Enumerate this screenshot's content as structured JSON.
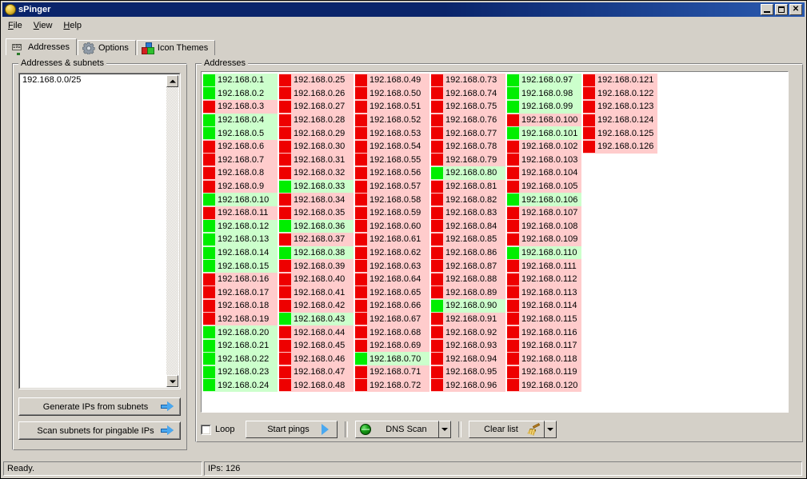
{
  "window": {
    "title": "sPinger",
    "icon": "app-ball-icon",
    "minimize_label": "Minimize",
    "maximize_label": "Maximize",
    "close_label": "Close"
  },
  "menu": {
    "items": [
      {
        "label": "File"
      },
      {
        "label": "View"
      },
      {
        "label": "Help"
      }
    ]
  },
  "tabs": [
    {
      "label": "Addresses",
      "icon": "ip-display-icon",
      "active": true
    },
    {
      "label": "Options",
      "icon": "gear-icon",
      "active": false
    },
    {
      "label": "Icon Themes",
      "icon": "blocks-icon",
      "active": false
    }
  ],
  "left_panel": {
    "group_title": "Addresses & subnets",
    "textarea_value": "192.168.0.0/25",
    "scroll_up_icon": "scroll-up-arrow-icon",
    "scroll_down_icon": "scroll-down-arrow-icon",
    "buttons": [
      {
        "label": "Generate IPs from subnets",
        "icon": "blue-right-arrow-icon"
      },
      {
        "label": "Scan subnets for pingable IPs",
        "icon": "blue-right-arrow-icon"
      }
    ]
  },
  "right_panel": {
    "group_title": "Addresses"
  },
  "toolbar": {
    "loop_label": "Loop",
    "loop_checked": false,
    "start_pings_label": "Start pings",
    "start_pings_icon": "play-triangle-icon",
    "dns_scan_label": "DNS Scan",
    "dns_scan_icon": "green-globe-icon",
    "dns_scan_dropdown_icon": "chevron-down-icon",
    "clear_list_label": "Clear list",
    "clear_list_icon": "broom-icon",
    "clear_list_dropdown_icon": "chevron-down-icon"
  },
  "statusbar": {
    "ready_text": "Ready.",
    "ips_text": "IPs: 126"
  },
  "colors": {
    "up_square": "#00ee00",
    "up_row_bg": "#ccffcc",
    "down_square": "#ee0000",
    "down_row_bg": "#ffcccc",
    "window_face": "#d4d0c8",
    "titlebar": "#0a246a"
  },
  "addresses": {
    "total": 126,
    "columns": [
      [
        {
          "ip": "192.168.0.1",
          "status": "up"
        },
        {
          "ip": "192.168.0.2",
          "status": "up"
        },
        {
          "ip": "192.168.0.3",
          "status": "down"
        },
        {
          "ip": "192.168.0.4",
          "status": "up"
        },
        {
          "ip": "192.168.0.5",
          "status": "up"
        },
        {
          "ip": "192.168.0.6",
          "status": "down"
        },
        {
          "ip": "192.168.0.7",
          "status": "down"
        },
        {
          "ip": "192.168.0.8",
          "status": "down"
        },
        {
          "ip": "192.168.0.9",
          "status": "down"
        },
        {
          "ip": "192.168.0.10",
          "status": "up"
        },
        {
          "ip": "192.168.0.11",
          "status": "down"
        },
        {
          "ip": "192.168.0.12",
          "status": "up"
        },
        {
          "ip": "192.168.0.13",
          "status": "up"
        },
        {
          "ip": "192.168.0.14",
          "status": "up"
        },
        {
          "ip": "192.168.0.15",
          "status": "up"
        },
        {
          "ip": "192.168.0.16",
          "status": "down"
        },
        {
          "ip": "192.168.0.17",
          "status": "down"
        },
        {
          "ip": "192.168.0.18",
          "status": "down"
        },
        {
          "ip": "192.168.0.19",
          "status": "down"
        },
        {
          "ip": "192.168.0.20",
          "status": "up"
        },
        {
          "ip": "192.168.0.21",
          "status": "up"
        },
        {
          "ip": "192.168.0.22",
          "status": "up"
        },
        {
          "ip": "192.168.0.23",
          "status": "up"
        },
        {
          "ip": "192.168.0.24",
          "status": "up"
        }
      ],
      [
        {
          "ip": "192.168.0.25",
          "status": "down"
        },
        {
          "ip": "192.168.0.26",
          "status": "down"
        },
        {
          "ip": "192.168.0.27",
          "status": "down"
        },
        {
          "ip": "192.168.0.28",
          "status": "down"
        },
        {
          "ip": "192.168.0.29",
          "status": "down"
        },
        {
          "ip": "192.168.0.30",
          "status": "down"
        },
        {
          "ip": "192.168.0.31",
          "status": "down"
        },
        {
          "ip": "192.168.0.32",
          "status": "down"
        },
        {
          "ip": "192.168.0.33",
          "status": "up"
        },
        {
          "ip": "192.168.0.34",
          "status": "down"
        },
        {
          "ip": "192.168.0.35",
          "status": "down"
        },
        {
          "ip": "192.168.0.36",
          "status": "up"
        },
        {
          "ip": "192.168.0.37",
          "status": "down"
        },
        {
          "ip": "192.168.0.38",
          "status": "up"
        },
        {
          "ip": "192.168.0.39",
          "status": "down"
        },
        {
          "ip": "192.168.0.40",
          "status": "down"
        },
        {
          "ip": "192.168.0.41",
          "status": "down"
        },
        {
          "ip": "192.168.0.42",
          "status": "down"
        },
        {
          "ip": "192.168.0.43",
          "status": "up"
        },
        {
          "ip": "192.168.0.44",
          "status": "down"
        },
        {
          "ip": "192.168.0.45",
          "status": "down"
        },
        {
          "ip": "192.168.0.46",
          "status": "down"
        },
        {
          "ip": "192.168.0.47",
          "status": "down"
        },
        {
          "ip": "192.168.0.48",
          "status": "down"
        }
      ],
      [
        {
          "ip": "192.168.0.49",
          "status": "down"
        },
        {
          "ip": "192.168.0.50",
          "status": "down"
        },
        {
          "ip": "192.168.0.51",
          "status": "down"
        },
        {
          "ip": "192.168.0.52",
          "status": "down"
        },
        {
          "ip": "192.168.0.53",
          "status": "down"
        },
        {
          "ip": "192.168.0.54",
          "status": "down"
        },
        {
          "ip": "192.168.0.55",
          "status": "down"
        },
        {
          "ip": "192.168.0.56",
          "status": "down"
        },
        {
          "ip": "192.168.0.57",
          "status": "down"
        },
        {
          "ip": "192.168.0.58",
          "status": "down"
        },
        {
          "ip": "192.168.0.59",
          "status": "down"
        },
        {
          "ip": "192.168.0.60",
          "status": "down"
        },
        {
          "ip": "192.168.0.61",
          "status": "down"
        },
        {
          "ip": "192.168.0.62",
          "status": "down"
        },
        {
          "ip": "192.168.0.63",
          "status": "down"
        },
        {
          "ip": "192.168.0.64",
          "status": "down"
        },
        {
          "ip": "192.168.0.65",
          "status": "down"
        },
        {
          "ip": "192.168.0.66",
          "status": "down"
        },
        {
          "ip": "192.168.0.67",
          "status": "down"
        },
        {
          "ip": "192.168.0.68",
          "status": "down"
        },
        {
          "ip": "192.168.0.69",
          "status": "down"
        },
        {
          "ip": "192.168.0.70",
          "status": "up"
        },
        {
          "ip": "192.168.0.71",
          "status": "down"
        },
        {
          "ip": "192.168.0.72",
          "status": "down"
        }
      ],
      [
        {
          "ip": "192.168.0.73",
          "status": "down"
        },
        {
          "ip": "192.168.0.74",
          "status": "down"
        },
        {
          "ip": "192.168.0.75",
          "status": "down"
        },
        {
          "ip": "192.168.0.76",
          "status": "down"
        },
        {
          "ip": "192.168.0.77",
          "status": "down"
        },
        {
          "ip": "192.168.0.78",
          "status": "down"
        },
        {
          "ip": "192.168.0.79",
          "status": "down"
        },
        {
          "ip": "192.168.0.80",
          "status": "up"
        },
        {
          "ip": "192.168.0.81",
          "status": "down"
        },
        {
          "ip": "192.168.0.82",
          "status": "down"
        },
        {
          "ip": "192.168.0.83",
          "status": "down"
        },
        {
          "ip": "192.168.0.84",
          "status": "down"
        },
        {
          "ip": "192.168.0.85",
          "status": "down"
        },
        {
          "ip": "192.168.0.86",
          "status": "down"
        },
        {
          "ip": "192.168.0.87",
          "status": "down"
        },
        {
          "ip": "192.168.0.88",
          "status": "down"
        },
        {
          "ip": "192.168.0.89",
          "status": "down"
        },
        {
          "ip": "192.168.0.90",
          "status": "up"
        },
        {
          "ip": "192.168.0.91",
          "status": "down"
        },
        {
          "ip": "192.168.0.92",
          "status": "down"
        },
        {
          "ip": "192.168.0.93",
          "status": "down"
        },
        {
          "ip": "192.168.0.94",
          "status": "down"
        },
        {
          "ip": "192.168.0.95",
          "status": "down"
        },
        {
          "ip": "192.168.0.96",
          "status": "down"
        }
      ],
      [
        {
          "ip": "192.168.0.97",
          "status": "up"
        },
        {
          "ip": "192.168.0.98",
          "status": "up"
        },
        {
          "ip": "192.168.0.99",
          "status": "up"
        },
        {
          "ip": "192.168.0.100",
          "status": "down"
        },
        {
          "ip": "192.168.0.101",
          "status": "up"
        },
        {
          "ip": "192.168.0.102",
          "status": "down"
        },
        {
          "ip": "192.168.0.103",
          "status": "down"
        },
        {
          "ip": "192.168.0.104",
          "status": "down"
        },
        {
          "ip": "192.168.0.105",
          "status": "down"
        },
        {
          "ip": "192.168.0.106",
          "status": "up"
        },
        {
          "ip": "192.168.0.107",
          "status": "down"
        },
        {
          "ip": "192.168.0.108",
          "status": "down"
        },
        {
          "ip": "192.168.0.109",
          "status": "down"
        },
        {
          "ip": "192.168.0.110",
          "status": "up"
        },
        {
          "ip": "192.168.0.111",
          "status": "down"
        },
        {
          "ip": "192.168.0.112",
          "status": "down"
        },
        {
          "ip": "192.168.0.113",
          "status": "down"
        },
        {
          "ip": "192.168.0.114",
          "status": "down"
        },
        {
          "ip": "192.168.0.115",
          "status": "down"
        },
        {
          "ip": "192.168.0.116",
          "status": "down"
        },
        {
          "ip": "192.168.0.117",
          "status": "down"
        },
        {
          "ip": "192.168.0.118",
          "status": "down"
        },
        {
          "ip": "192.168.0.119",
          "status": "down"
        },
        {
          "ip": "192.168.0.120",
          "status": "down"
        }
      ],
      [
        {
          "ip": "192.168.0.121",
          "status": "down"
        },
        {
          "ip": "192.168.0.122",
          "status": "down"
        },
        {
          "ip": "192.168.0.123",
          "status": "down"
        },
        {
          "ip": "192.168.0.124",
          "status": "down"
        },
        {
          "ip": "192.168.0.125",
          "status": "down"
        },
        {
          "ip": "192.168.0.126",
          "status": "down"
        }
      ]
    ]
  }
}
